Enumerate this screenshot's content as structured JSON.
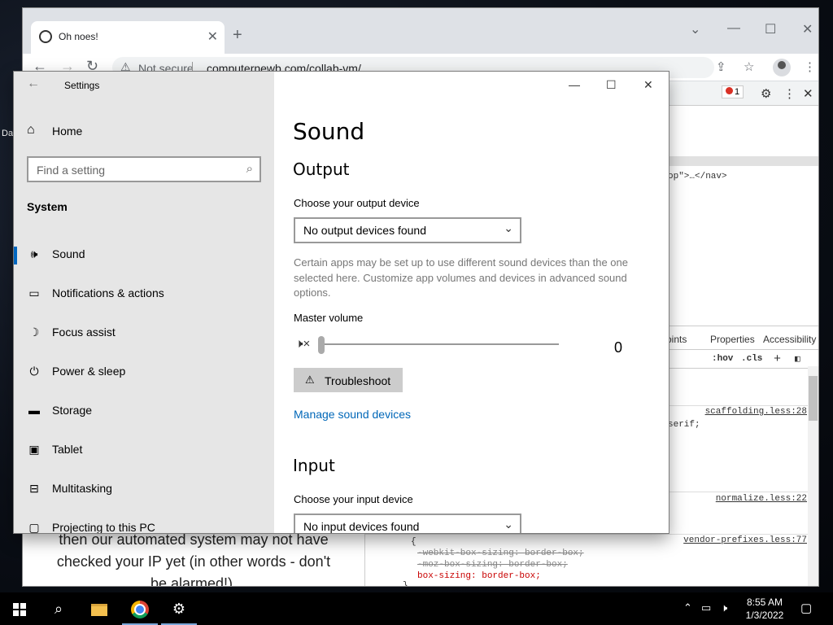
{
  "desktop": {
    "icon_label": "Da"
  },
  "browser": {
    "tab_title": "Oh noes!",
    "security_label": "Not secure",
    "url": "computernewb.com/collab-vm/",
    "icons": [
      "back-arrow-icon",
      "forward-arrow-icon",
      "reload-icon",
      "warning-icon",
      "share-icon",
      "star-icon",
      "profile-icon",
      "kebab-menu-icon"
    ],
    "page_text": [
      "then our automated system may not have",
      "checked your IP yet (in other words - don't",
      "be alarmed!)."
    ]
  },
  "devtools": {
    "error_count": "1",
    "html_snippet": "op\">…</nav>",
    "tabs": [
      "oints",
      "Properties",
      "Accessibility"
    ],
    "filter_tools": [
      ":hov",
      ".cls",
      "+"
    ],
    "rules": [
      {
        "source": "scaffolding.less:28",
        "line": "serif;"
      },
      {
        "source": "normalize.less:22"
      },
      {
        "source": "vendor-prefixes.less:77",
        "lines": [
          "-webkit-box-sizing: border-box;",
          "-moz-box-sizing: border-box;",
          "box-sizing: border-box;"
        ],
        "close": "}",
        "open": "{"
      }
    ]
  },
  "settings": {
    "app_title": "Settings",
    "home": "Home",
    "search_placeholder": "Find a setting",
    "section": "System",
    "nav": [
      {
        "label": "Sound",
        "icon": "speaker-icon",
        "active": true
      },
      {
        "label": "Notifications & actions",
        "icon": "notification-icon"
      },
      {
        "label": "Focus assist",
        "icon": "moon-icon"
      },
      {
        "label": "Power & sleep",
        "icon": "power-icon"
      },
      {
        "label": "Storage",
        "icon": "storage-icon"
      },
      {
        "label": "Tablet",
        "icon": "tablet-icon"
      },
      {
        "label": "Multitasking",
        "icon": "multitasking-icon"
      },
      {
        "label": "Projecting to this PC",
        "icon": "project-icon"
      }
    ],
    "page_title": "Sound",
    "output": {
      "heading": "Output",
      "device_label": "Choose your output device",
      "device_value": "No output devices found",
      "description": "Certain apps may be set up to use different sound devices than the one selected here. Customize app volumes and devices in advanced sound options.",
      "volume_label": "Master volume",
      "volume_value": "0",
      "volume_level": 0,
      "troubleshoot": "Troubleshoot",
      "manage_link": "Manage sound devices"
    },
    "input": {
      "heading": "Input",
      "device_label": "Choose your input device",
      "device_value": "No input devices found"
    }
  },
  "taskbar": {
    "time": "8:55 AM",
    "date": "1/3/2022",
    "items": [
      "start-button",
      "search-button",
      "file-explorer",
      "chrome",
      "settings"
    ]
  }
}
